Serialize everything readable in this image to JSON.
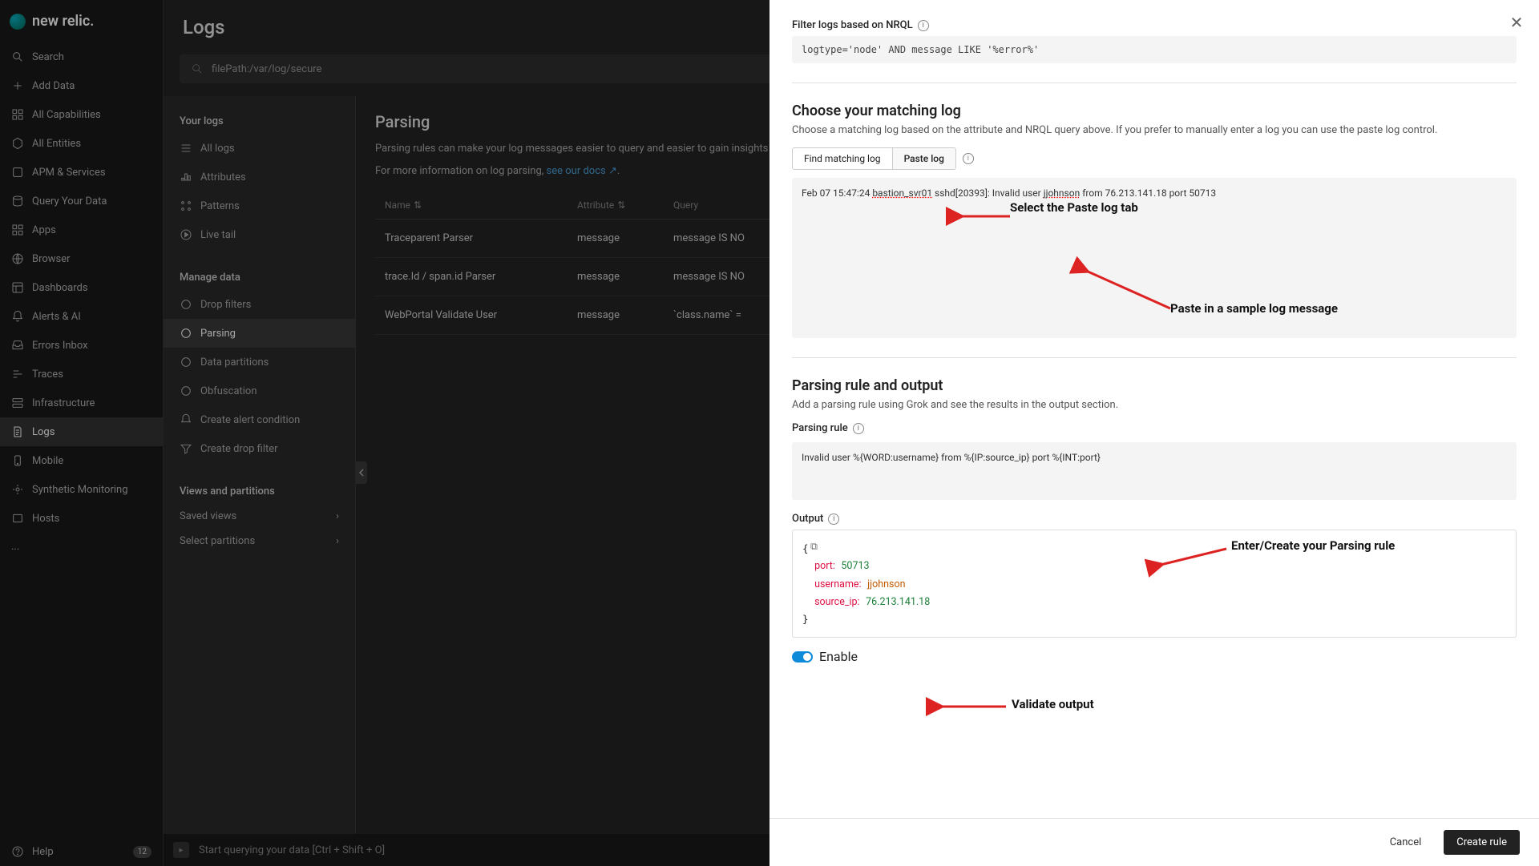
{
  "brand": "new relic.",
  "nav": {
    "search": "Search",
    "add_data": "Add Data",
    "all_capabilities": "All Capabilities",
    "all_entities": "All Entities",
    "apm": "APM & Services",
    "query": "Query Your Data",
    "apps": "Apps",
    "browser": "Browser",
    "dashboards": "Dashboards",
    "alerts": "Alerts & AI",
    "errors": "Errors Inbox",
    "traces": "Traces",
    "infrastructure": "Infrastructure",
    "logs": "Logs",
    "mobile": "Mobile",
    "synthetic": "Synthetic Monitoring",
    "hosts": "Hosts",
    "more": "...",
    "help": "Help",
    "help_badge": "12"
  },
  "header": {
    "title": "Logs"
  },
  "search": {
    "text": "filePath:/var/log/secure"
  },
  "sub_sidebar": {
    "your_logs": "Your logs",
    "all_logs": "All logs",
    "attributes": "Attributes",
    "patterns": "Patterns",
    "live_tail": "Live tail",
    "manage_data": "Manage data",
    "drop_filters": "Drop filters",
    "parsing": "Parsing",
    "data_partitions": "Data partitions",
    "obfuscation": "Obfuscation",
    "create_alert": "Create alert condition",
    "create_drop": "Create drop filter",
    "views_partitions": "Views and partitions",
    "saved_views": "Saved views",
    "select_partitions": "Select partitions"
  },
  "parsing_panel": {
    "title": "Parsing",
    "desc1": "Parsing rules can make your log messages easier to query and easier to gain insights from. A parsing rule applies Grok patterns to the structure of log data stored after the rule is enabled. Previously stored logs w",
    "desc2_prefix": "For more information on log parsing, ",
    "docs_link": "see our docs",
    "table": {
      "col_name": "Name",
      "col_attr": "Attribute",
      "col_query": "Query",
      "rows": [
        {
          "name": "Traceparent Parser",
          "attr": "message",
          "query": "message IS NO"
        },
        {
          "name": "trace.Id / span.id Parser",
          "attr": "message",
          "query": "message IS NO"
        },
        {
          "name": "WebPortal Validate User",
          "attr": "message",
          "query": "`class.name` ="
        }
      ]
    }
  },
  "drawer": {
    "filter_label": "Filter logs based on NRQL",
    "filter_value": "logtype='node' AND message LIKE '%error%'",
    "choose_h": "Choose your matching log",
    "choose_p": "Choose a matching log based on the attribute and NRQL query above. If you prefer to manually enter a log you can use the paste log control.",
    "tab_find": "Find matching log",
    "tab_paste": "Paste log",
    "sample_log_prefix": "Feb 07 15:47:24 ",
    "sample_log_host1": "bastion_svr01",
    "sample_log_mid": " sshd[20393]: Invalid user ",
    "sample_log_user": "jjohnson",
    "sample_log_suffix": " from 76.213.141.18 port 50713",
    "rule_h": "Parsing rule and output",
    "rule_p": "Add a parsing rule using Grok and see the results in the output section.",
    "rule_label": "Parsing rule",
    "rule_value": "Invalid user %{WORD:username} from %{IP:source_ip} port %{INT:port}",
    "output_label": "Output",
    "output": {
      "port_key": "port:",
      "port_val": "50713",
      "user_key": "username:",
      "user_val": "jjohnson",
      "ip_key": "source_ip:",
      "ip_val": "76.213.141.18"
    },
    "enable": "Enable",
    "cancel": "Cancel",
    "create": "Create rule"
  },
  "annotations": {
    "select_tab": "Select the Paste log tab",
    "paste_sample": "Paste in a sample log message",
    "enter_rule": "Enter/Create your Parsing rule",
    "validate": "Validate output"
  },
  "query_bar": {
    "placeholder": "Start querying your data [Ctrl + Shift + O]"
  }
}
